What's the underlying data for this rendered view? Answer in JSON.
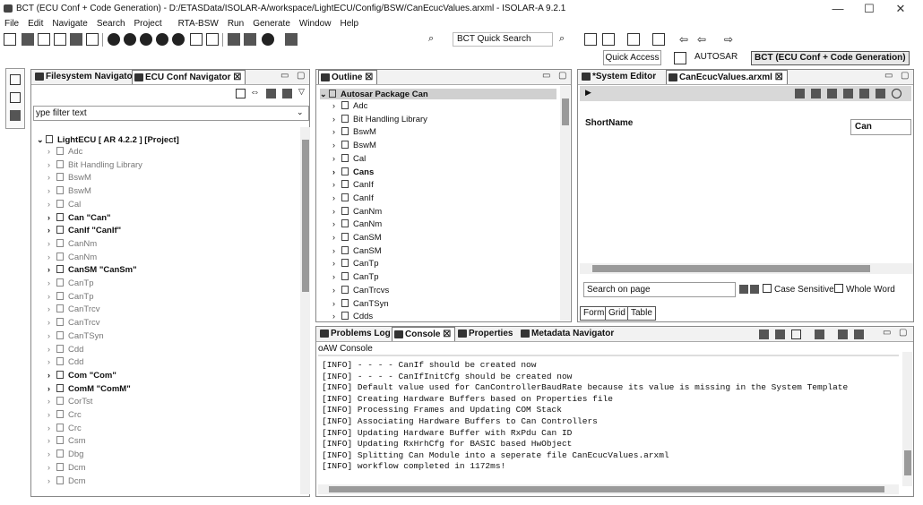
{
  "window": {
    "title": "BCT (ECU Conf + Code Generation) - D:/ETASData/ISOLAR-A/workspace/LightECU/Config/BSW/CanEcucValues.arxml - ISOLAR-A 9.2.1",
    "min": "—",
    "max": "☐",
    "close": "✕"
  },
  "menu": [
    "File",
    "Edit",
    "Navigate",
    "Search",
    "Project",
    "RTA-BSW",
    "Run",
    "Generate",
    "Window",
    "Help"
  ],
  "toolbar": {
    "quick_search": "BCT Quick Search"
  },
  "perspectives": {
    "quick_access": "Quick Access",
    "autosar": "AUTOSAR",
    "bct": "BCT (ECU Conf + Code Generation)"
  },
  "navigator": {
    "tab_fs": "Filesystem Navigator",
    "tab_ecu": "ECU Conf Navigator",
    "filter_placeholder": "ype filter text",
    "project": "LightECU [ AR 4.2.2 ] [Project]",
    "items": [
      {
        "label": "Adc",
        "style": "grey"
      },
      {
        "label": "Bit Handling Library",
        "style": "grey"
      },
      {
        "label": "BswM",
        "style": "grey"
      },
      {
        "label": "BswM",
        "style": "grey"
      },
      {
        "label": "Cal",
        "style": "grey"
      },
      {
        "label": "Can \"Can\"",
        "style": "bold"
      },
      {
        "label": "CanIf \"CanIf\"",
        "style": "bold"
      },
      {
        "label": "CanNm",
        "style": "grey"
      },
      {
        "label": "CanNm",
        "style": "grey"
      },
      {
        "label": "CanSM \"CanSm\"",
        "style": "bold"
      },
      {
        "label": "CanTp",
        "style": "grey"
      },
      {
        "label": "CanTp",
        "style": "grey"
      },
      {
        "label": "CanTrcv",
        "style": "grey"
      },
      {
        "label": "CanTrcv",
        "style": "grey"
      },
      {
        "label": "CanTSyn",
        "style": "grey"
      },
      {
        "label": "Cdd",
        "style": "grey"
      },
      {
        "label": "Cdd",
        "style": "grey"
      },
      {
        "label": "Com \"Com\"",
        "style": "bold"
      },
      {
        "label": "ComM \"ComM\"",
        "style": "bold"
      },
      {
        "label": "CorTst",
        "style": "grey"
      },
      {
        "label": "Crc",
        "style": "grey"
      },
      {
        "label": "Crc",
        "style": "grey"
      },
      {
        "label": "Csm",
        "style": "grey"
      },
      {
        "label": "Dbg",
        "style": "grey"
      },
      {
        "label": "Dcm",
        "style": "grey"
      },
      {
        "label": "Dcm",
        "style": "grey"
      }
    ]
  },
  "outline": {
    "tab": "Outline",
    "root": "Autosar Package Can",
    "items": [
      {
        "label": "Adc",
        "style": "normal"
      },
      {
        "label": "Bit Handling Library",
        "style": "normal"
      },
      {
        "label": "BswM",
        "style": "normal"
      },
      {
        "label": "BswM",
        "style": "normal"
      },
      {
        "label": "Cal",
        "style": "normal"
      },
      {
        "label": "Cans",
        "style": "bold"
      },
      {
        "label": "CanIf",
        "style": "normal"
      },
      {
        "label": "CanIf",
        "style": "normal"
      },
      {
        "label": "CanNm",
        "style": "normal"
      },
      {
        "label": "CanNm",
        "style": "normal"
      },
      {
        "label": "CanSM",
        "style": "normal"
      },
      {
        "label": "CanSM",
        "style": "normal"
      },
      {
        "label": "CanTp",
        "style": "normal"
      },
      {
        "label": "CanTp",
        "style": "normal"
      },
      {
        "label": "CanTrcvs",
        "style": "normal"
      },
      {
        "label": "CanTSyn",
        "style": "normal"
      },
      {
        "label": "Cdds",
        "style": "normal"
      }
    ]
  },
  "editor": {
    "tab_system": "*System Editor",
    "tab_file": "CanEcucValues.arxml",
    "shortname_label": "ShortName",
    "shortname_value": "Can",
    "search_placeholder": "Search on page",
    "case_sensitive": "Case Sensitive",
    "whole_word": "Whole Word",
    "tabs": [
      "Form",
      "Grid",
      "Table"
    ]
  },
  "console": {
    "tab_problems": "Problems Log",
    "tab_console": "Console",
    "tab_properties": "Properties",
    "tab_metadata": "Metadata Navigator",
    "title": "oAW Console",
    "lines": [
      "[INFO] - - - - CanIf should be created now",
      "[INFO] - - - - CanIfInitCfg should be created now",
      "[INFO] Default value used for CanControllerBaudRate because its value is missing in the System Template",
      "[INFO] Creating Hardware Buffers based on Properties file",
      "[INFO] Processing Frames and Updating COM Stack",
      "[INFO] Associating Hardware Buffers to Can Controllers",
      "[INFO] Updating Hardware Buffer with RxPdu Can ID",
      "[INFO] Updating RxHrhCfg for BASIC based HwObject",
      "[INFO] Splitting Can Module into a seperate file CanEcucValues.arxml",
      "[INFO] workflow completed in 1172ms!"
    ]
  }
}
